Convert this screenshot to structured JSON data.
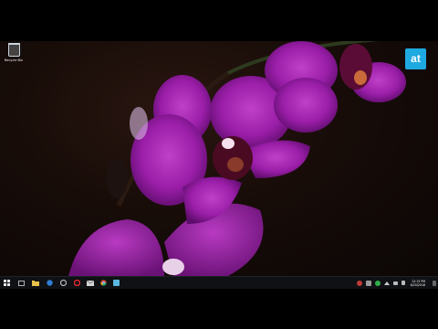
{
  "desktop": {
    "icons": [
      {
        "label": "Recycle Bin",
        "icon": "recycle-bin-icon"
      }
    ]
  },
  "overlay": {
    "brand_text": "at",
    "color": "#1fa9e1"
  },
  "taskbar": {
    "start_icon": "windows-start-icon",
    "apps": [
      {
        "name": "task-view",
        "icon": "task-view-icon"
      },
      {
        "name": "file-explorer",
        "icon": "folder-icon"
      },
      {
        "name": "edge",
        "icon": "edge-icon"
      },
      {
        "name": "settings",
        "icon": "gear-icon"
      },
      {
        "name": "opera",
        "icon": "opera-icon"
      },
      {
        "name": "mail",
        "icon": "mail-icon"
      },
      {
        "name": "chrome",
        "icon": "chrome-icon"
      },
      {
        "name": "app",
        "icon": "app-icon"
      }
    ],
    "tray": {
      "icons": [
        "shield-icon",
        "app-icon",
        "green-app-icon",
        "chevron-up-icon",
        "network-icon",
        "volume-icon",
        "notification-icon"
      ],
      "time": "12:15 PM",
      "date": "6/20/2018"
    }
  }
}
